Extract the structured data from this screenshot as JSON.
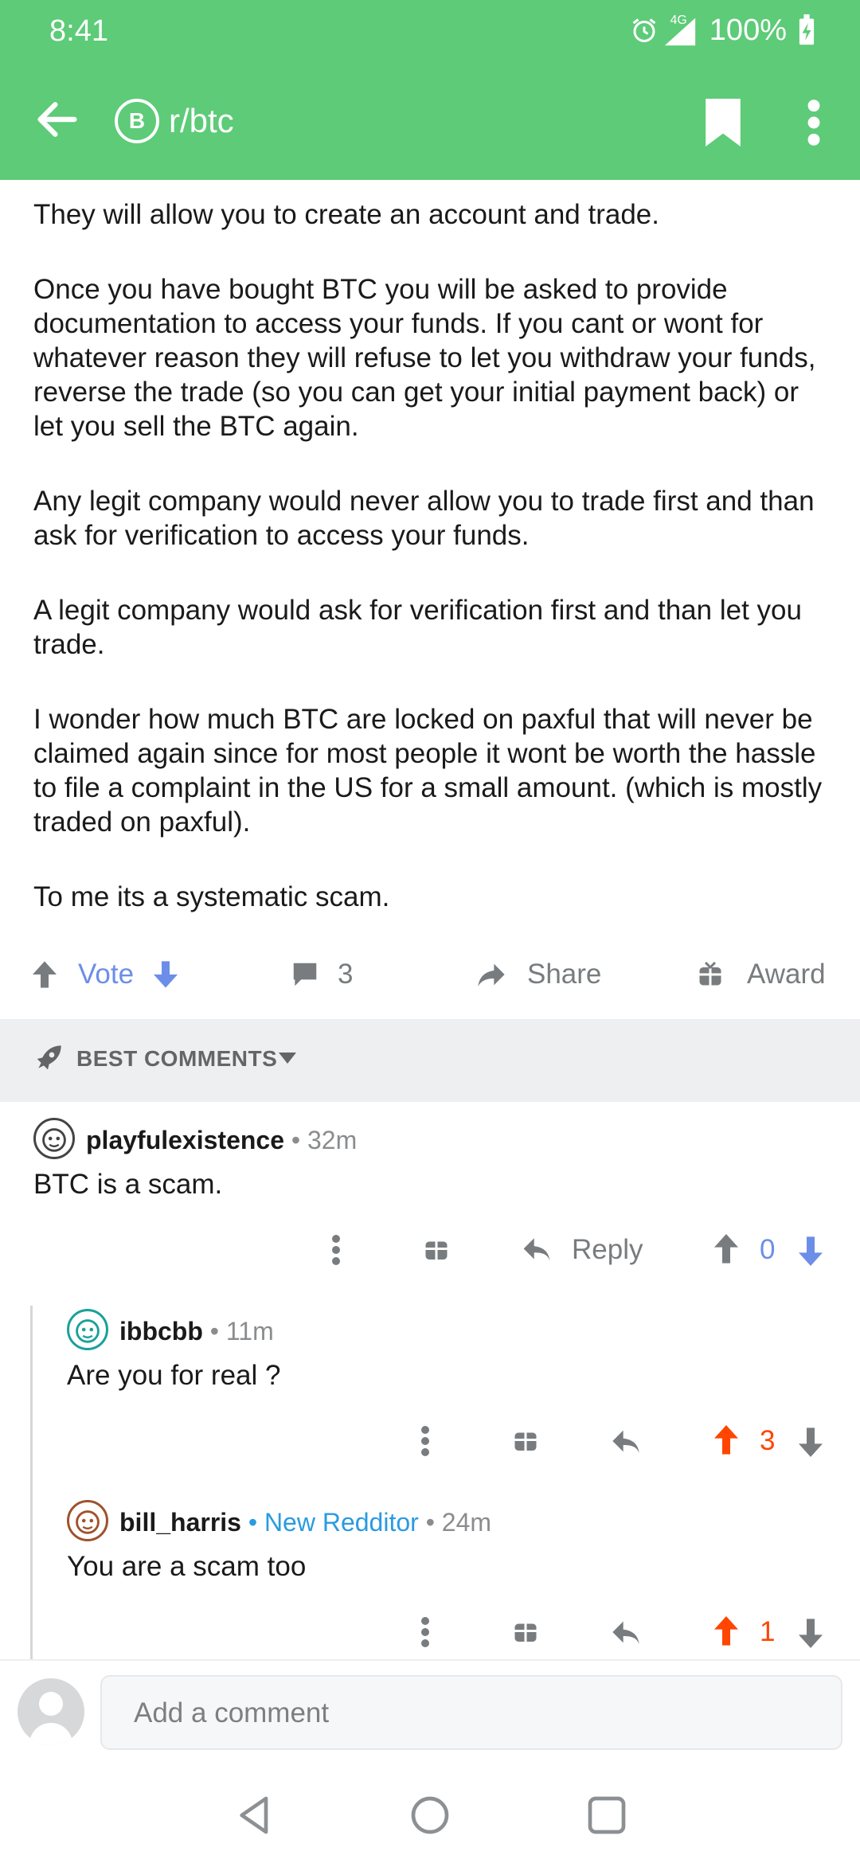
{
  "status": {
    "time": "8:41",
    "network": "4G",
    "battery": "100%"
  },
  "header": {
    "subreddit": "r/btc",
    "sub_icon_letter": "B"
  },
  "post": {
    "paragraphs": [
      "They will allow you to create an account and trade.",
      "Once you have bought BTC you will be asked to provide documentation to access your funds. If you cant or wont for whatever reason they will refuse to let you withdraw your funds, reverse the trade (so you can get your initial payment back) or let you sell the BTC again.",
      "Any legit company would never allow you to trade first and than ask for verification to access your funds.",
      "A legit company would ask for verification first and than let you trade.",
      "I wonder how much BTC are locked on paxful that will never be claimed again since for most people it wont be worth the hassle to file a complaint in the US for a small amount. (which is mostly traded on paxful).",
      "To me its a systematic scam."
    ],
    "actions": {
      "vote": "Vote",
      "comments": "3",
      "share": "Share",
      "award": "Award"
    }
  },
  "sort": {
    "label": "BEST COMMENTS"
  },
  "comments": [
    {
      "user": "playfulexistence",
      "time": "• 32m",
      "body": "BTC is a scam.",
      "reply": "Reply",
      "score": "0"
    },
    {
      "user": "ibbcbb",
      "time": "• 11m",
      "body": "Are you for real ?",
      "score": "3"
    },
    {
      "user": "bill_harris",
      "flair": "• New Redditor",
      "time": "• 24m",
      "body": "You are a scam too",
      "score": "1"
    }
  ],
  "composer": {
    "placeholder": "Add a comment"
  },
  "colors": {
    "header_green": "#5dcb78",
    "upvote_orange": "#ff4500",
    "vote_blue": "#6c8ee8",
    "flair_blue": "#2a9be0"
  }
}
